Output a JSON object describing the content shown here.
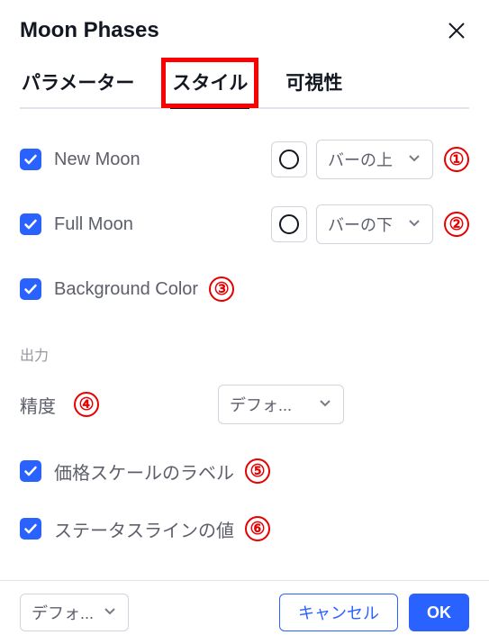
{
  "title": "Moon Phases",
  "tabs": {
    "parameters": "パラメーター",
    "style": "スタイル",
    "visibility": "可視性"
  },
  "rows": {
    "new_moon": {
      "label": "New Moon",
      "select": "バーの上"
    },
    "full_moon": {
      "label": "Full Moon",
      "select": "バーの下"
    },
    "bg_color": {
      "label": "Background Color"
    }
  },
  "output_section": "出力",
  "precision": {
    "label": "精度",
    "select": "デフォ..."
  },
  "price_scale_label": "価格スケールのラベル",
  "status_line_value": "ステータスラインの値",
  "annotations": {
    "a1": "①",
    "a2": "②",
    "a3": "③",
    "a4": "④",
    "a5": "⑤",
    "a6": "⑥"
  },
  "footer": {
    "preset_select": "デフォ...",
    "cancel": "キャンセル",
    "ok": "OK"
  }
}
